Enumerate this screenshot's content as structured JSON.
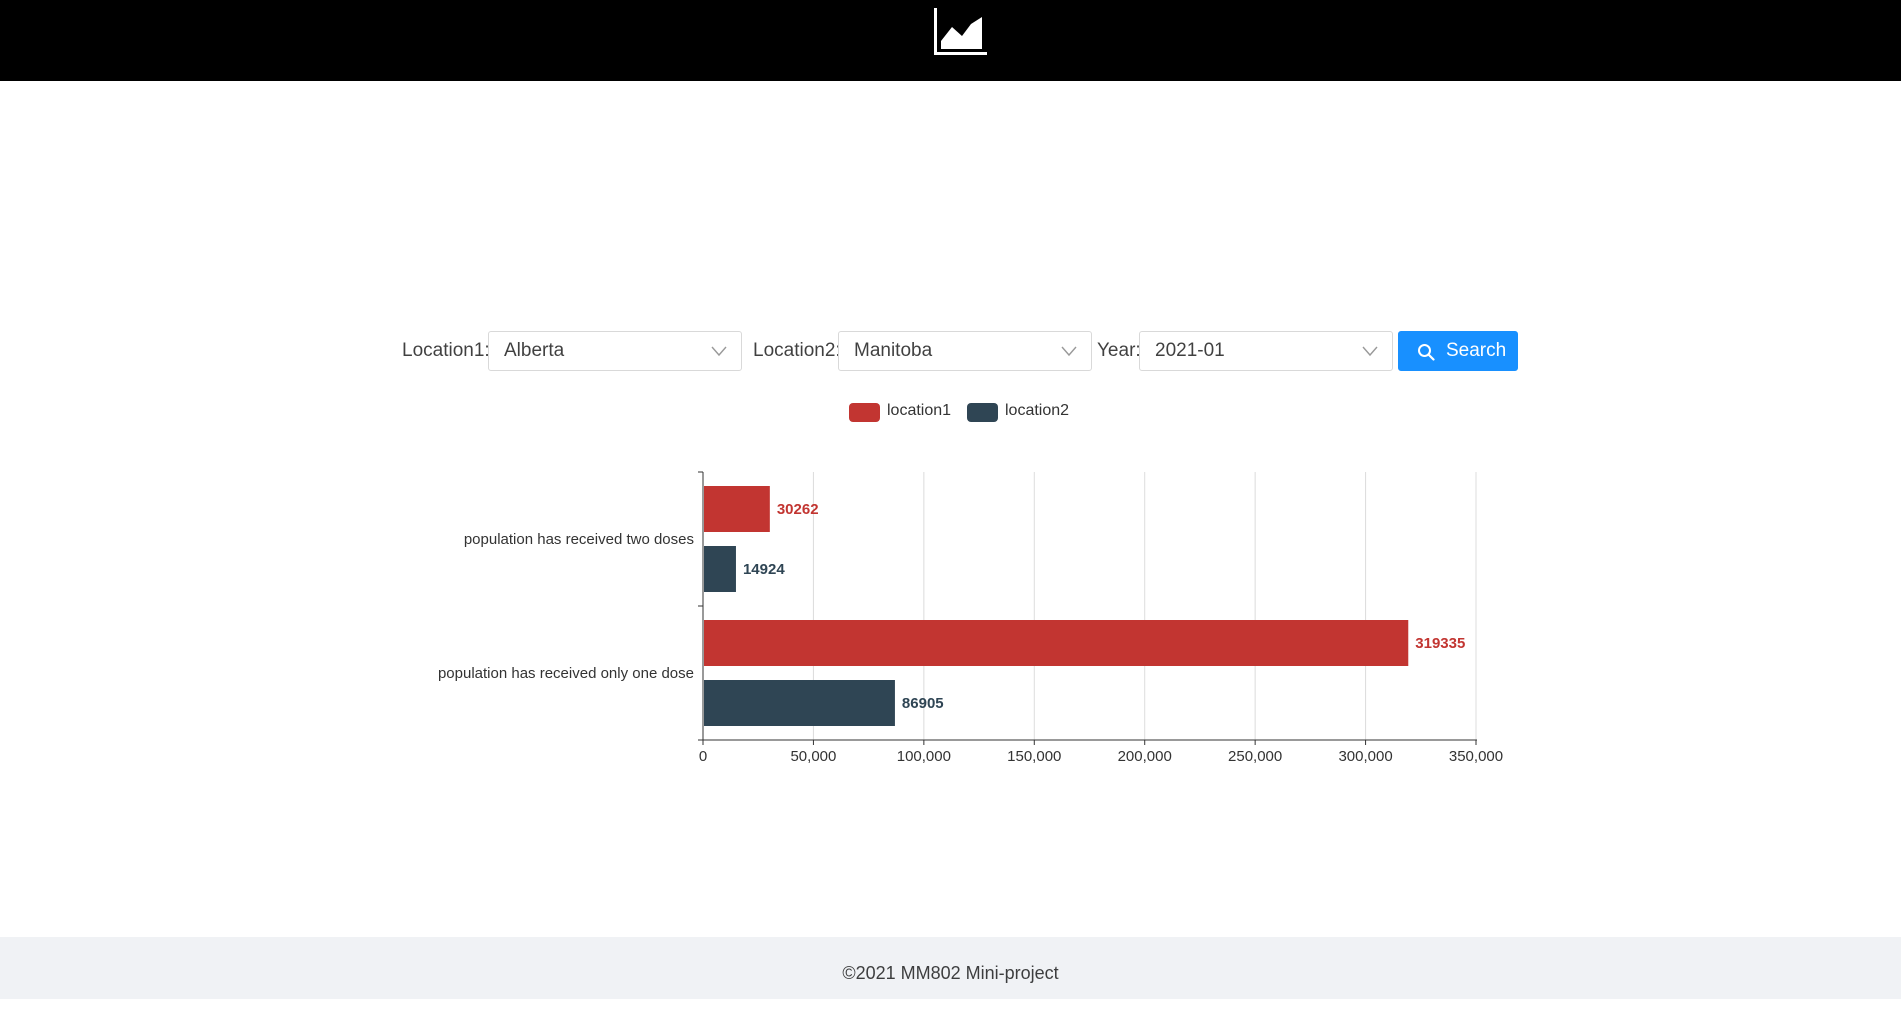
{
  "header": {
    "logo_icon": "area-chart-icon"
  },
  "controls": {
    "location1_label": "Location1:",
    "location1_value": "Alberta",
    "location2_label": "Location2:",
    "location2_value": "Manitoba",
    "year_label": "Year:",
    "year_value": "2021-01",
    "search_label": "Search",
    "search_icon": "search-icon",
    "chevron_icon": "chevron-down-icon",
    "button_color": "#1890ff"
  },
  "chart_data": {
    "type": "bar",
    "orientation": "horizontal",
    "categories": [
      "population has received two doses",
      "population has received only one dose"
    ],
    "series": [
      {
        "name": "location1",
        "color": "#c23531",
        "values": [
          30262,
          319335
        ]
      },
      {
        "name": "location2",
        "color": "#2f4554",
        "values": [
          14924,
          86905
        ]
      }
    ],
    "xlim": [
      0,
      350000
    ],
    "xticks": [
      0,
      50000,
      100000,
      150000,
      200000,
      250000,
      300000,
      350000
    ],
    "xtick_labels": [
      "0",
      "50,000",
      "100,000",
      "150,000",
      "200,000",
      "250,000",
      "300,000",
      "350,000"
    ],
    "grid": true,
    "legend_position": "top-center",
    "data_labels": true
  },
  "footer": {
    "text": "©2021 MM802 Mini-project"
  }
}
